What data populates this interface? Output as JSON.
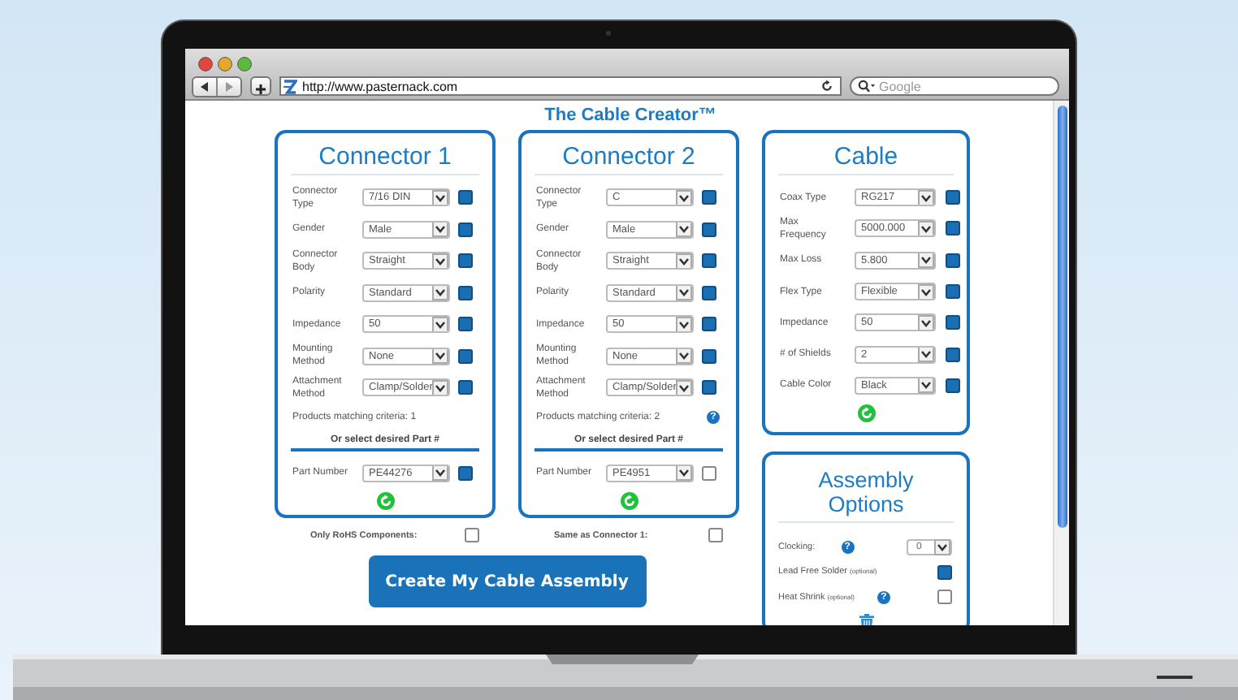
{
  "browser": {
    "url": "http://www.pasternack.com",
    "search_placeholder": "Google"
  },
  "page_title": "The Cable Creator™",
  "connectors": [
    {
      "title": "Connector 1",
      "fields": [
        {
          "label": "Connector Type",
          "value": "7/16 DIN",
          "checked": true
        },
        {
          "label": "Gender",
          "value": "Male",
          "checked": true
        },
        {
          "label": "Connector Body",
          "value": "Straight",
          "checked": true
        },
        {
          "label": "Polarity",
          "value": "Standard",
          "checked": true
        },
        {
          "label": "Impedance",
          "value": "50",
          "checked": true
        },
        {
          "label": "Mounting Method",
          "value": "None",
          "checked": true
        },
        {
          "label": "Attachment Method",
          "value": "Clamp/Solder",
          "checked": true
        }
      ],
      "matching": "Products matching criteria: 1",
      "part_heading": "Or select desired Part #",
      "part": {
        "label": "Part Number",
        "value": "PE44276",
        "checked": true
      },
      "footer_option": {
        "label": "Only RoHS Components:",
        "checked": false
      }
    },
    {
      "title": "Connector 2",
      "fields": [
        {
          "label": "Connector Type",
          "value": "C",
          "checked": true
        },
        {
          "label": "Gender",
          "value": "Male",
          "checked": true
        },
        {
          "label": "Connector Body",
          "value": "Straight",
          "checked": true
        },
        {
          "label": "Polarity",
          "value": "Standard",
          "checked": true
        },
        {
          "label": "Impedance",
          "value": "50",
          "checked": true
        },
        {
          "label": "Mounting Method",
          "value": "None",
          "checked": true
        },
        {
          "label": "Attachment Method",
          "value": "Clamp/Solder",
          "checked": true
        }
      ],
      "matching": "Products matching criteria: 2",
      "help": "?",
      "part_heading": "Or select desired Part #",
      "part": {
        "label": "Part Number",
        "value": "PE4951",
        "checked": false
      },
      "footer_option": {
        "label": "Same as Connector 1:",
        "checked": false
      }
    }
  ],
  "cable": {
    "title": "Cable",
    "fields": [
      {
        "label": "Coax Type",
        "value": "RG217",
        "checked": true
      },
      {
        "label": "Max Frequency",
        "value": "5000.000",
        "checked": true
      },
      {
        "label": "Max Loss",
        "value": "5.800",
        "checked": true
      },
      {
        "label": "Flex Type",
        "value": "Flexible",
        "checked": true
      },
      {
        "label": "Impedance",
        "value": "50",
        "checked": true
      },
      {
        "label": "# of Shields",
        "value": "2",
        "checked": true
      },
      {
        "label": "Cable Color",
        "value": "Black",
        "checked": true
      }
    ]
  },
  "assembly": {
    "title": "Assembly Options",
    "options": [
      {
        "kind": "select",
        "label": "Clocking:",
        "help": "?",
        "value": "0"
      },
      {
        "kind": "checkbox",
        "label": "Lead Free Solder",
        "note": "(optional)",
        "checked": true
      },
      {
        "kind": "checkbox",
        "label": "Heat Shrink",
        "note": "(optional)",
        "help": "?",
        "checked": false
      }
    ]
  },
  "submit_button": "Create My Cable Assembly"
}
